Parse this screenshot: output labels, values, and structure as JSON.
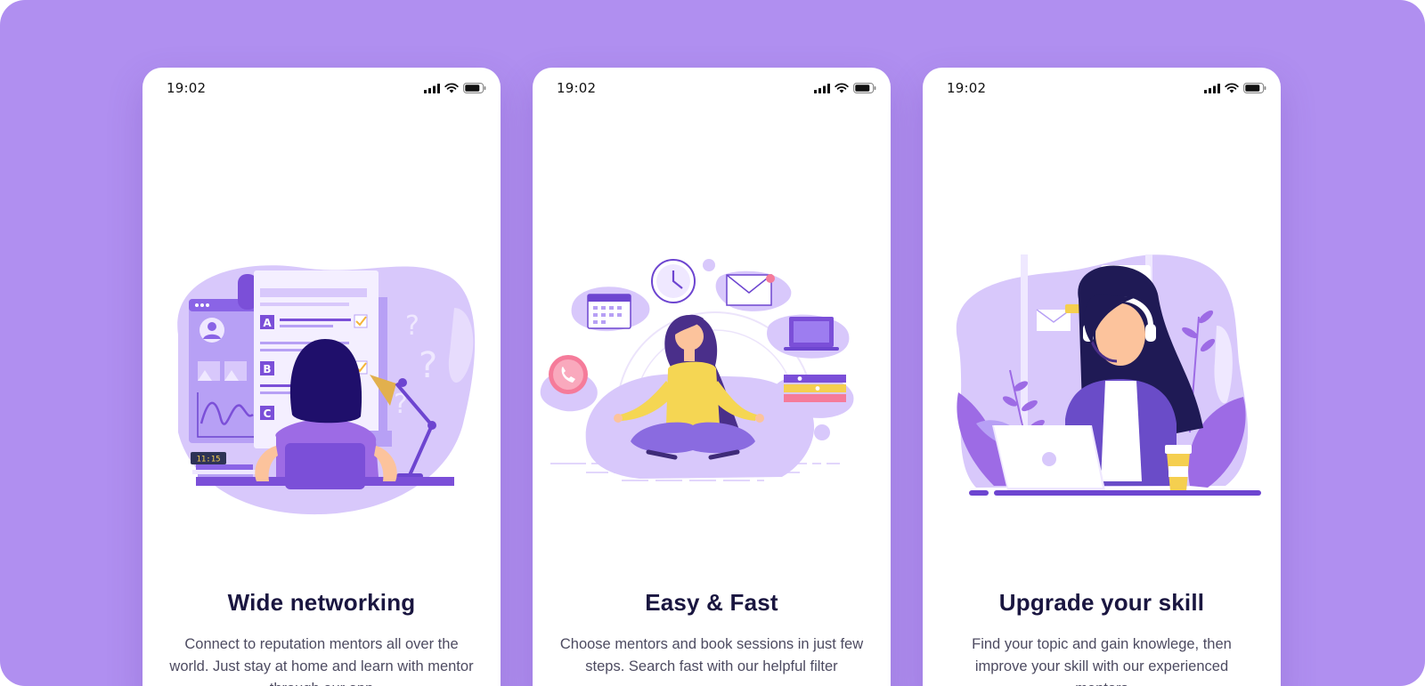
{
  "colors": {
    "background": "#b08ff0",
    "card": "#ffffff",
    "title": "#1a1640",
    "body": "#4d4b61",
    "accent": "#7b4fd8",
    "accent_light": "#d8c8fb",
    "yellow": "#f5cf4f"
  },
  "screens": [
    {
      "status_time": "19:02",
      "illustration": "woman-studying-checklist",
      "title": "Wide networking",
      "description": "Connect to reputation mentors all over the world. Just stay at home and learn with mentor through our app",
      "checklist_marks": [
        "A",
        "B",
        "C"
      ],
      "clock_readout": "11:15"
    },
    {
      "status_time": "19:02",
      "illustration": "woman-meditating-with-icons",
      "title": "Easy & Fast",
      "description": "Choose mentors and book sessions in just few steps. Search fast with our helpful filter"
    },
    {
      "status_time": "19:02",
      "illustration": "woman-with-headset-laptop",
      "title": "Upgrade your skill",
      "description": "Find your topic and gain knowlege, then improve your skill with our experienced mentors"
    }
  ]
}
